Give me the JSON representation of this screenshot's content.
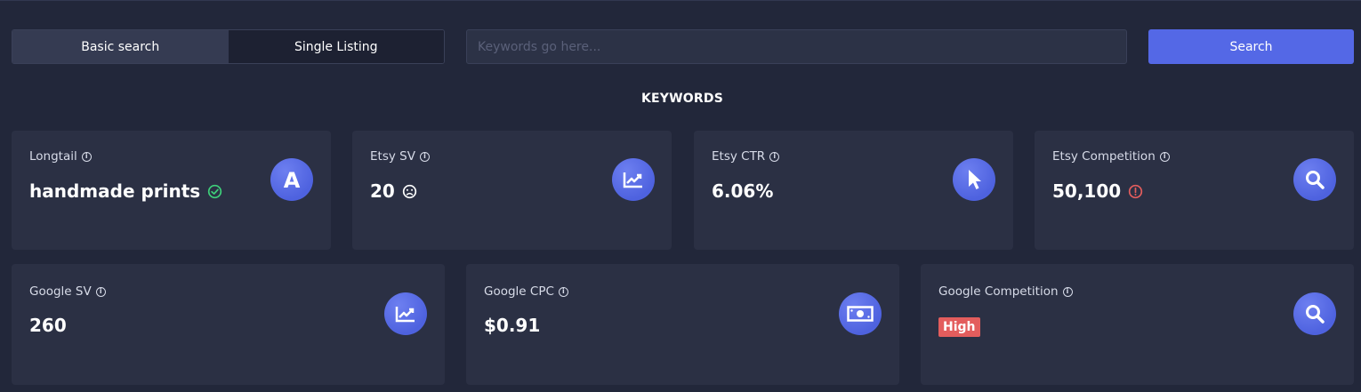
{
  "tabs": [
    {
      "label": "Basic search",
      "active": true
    },
    {
      "label": "Single Listing",
      "active": false
    }
  ],
  "search": {
    "placeholder": "Keywords go here...",
    "value": "",
    "button_label": "Search"
  },
  "section_title": "KEYWORDS",
  "cards": {
    "longtail": {
      "label": "Longtail",
      "value": "handmade prints",
      "status_icon": "check-circle-icon",
      "icon": "letter-a-icon"
    },
    "etsy_sv": {
      "label": "Etsy SV",
      "value": "20",
      "status_icon": "sad-face-icon",
      "icon": "chart-line-icon"
    },
    "etsy_ctr": {
      "label": "Etsy CTR",
      "value": "6.06%",
      "icon": "cursor-icon"
    },
    "etsy_competition": {
      "label": "Etsy Competition",
      "value": "50,100",
      "status_icon": "alert-circle-icon",
      "icon": "magnifier-icon"
    },
    "google_sv": {
      "label": "Google SV",
      "value": "260",
      "icon": "chart-line-icon"
    },
    "google_cpc": {
      "label": "Google CPC",
      "value": "$0.91",
      "icon": "money-bill-icon"
    },
    "google_competition": {
      "label": "Google Competition",
      "value": "High",
      "icon": "magnifier-icon"
    }
  },
  "colors": {
    "background": "#22273a",
    "card": "#2b3044",
    "accent": "#5468e6",
    "success": "#3ecf7a",
    "danger": "#e35d5d"
  }
}
